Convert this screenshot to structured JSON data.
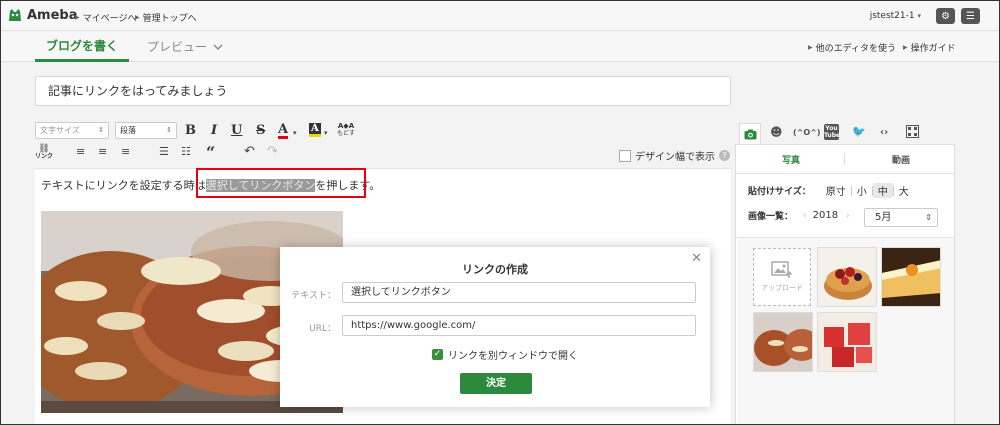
{
  "brand": {
    "name": "Ameba",
    "color": "#2b8a3e"
  },
  "topnav": {
    "mypage": "マイページへ",
    "admin_top": "管理トップへ",
    "user": "jstest21-1"
  },
  "tabs": {
    "write": "ブログを書く",
    "preview": "プレビュー"
  },
  "tablinks": {
    "other_editor": "他のエディタを使う",
    "guide": "操作ガイド"
  },
  "title": "記事にリンクをはってみましょう",
  "toolbar": {
    "font_size": "文字サイズ",
    "paragraph": "段落",
    "bold": "B",
    "italic": "I",
    "underline": "U",
    "strike": "S",
    "font_color": "A",
    "bg_color": "A",
    "clear_format_top": "A◆A",
    "clear_format_bottom": "もどす",
    "link": "リンク",
    "quote": "“",
    "design_width": "デザイン幅で表示"
  },
  "editor": {
    "text_before": "テキストにリンクを設定する時は",
    "text_selected": "選択してリンクボタン",
    "text_after": "を押します。"
  },
  "panel": {
    "icons": [
      "camera-icon",
      "emoji-icon",
      "kaomoji-icon",
      "youtube-icon",
      "twitter-icon",
      "embed-icon",
      "qr-icon"
    ],
    "kaomoji": "(^O^)",
    "youtube": "You Tube",
    "embed": "‹›",
    "subtabs": {
      "photo": "写真",
      "video": "動画"
    },
    "paste_size_label": "貼付けサイズ：",
    "sizes": [
      "原寸",
      "小",
      "中",
      "大"
    ],
    "selected_size": "中",
    "image_list_label": "画像一覧：",
    "year": "2018",
    "month": "5月",
    "upload": "アップロード"
  },
  "modal": {
    "title": "リンクの作成",
    "text_label": "テキスト：",
    "text_value": "選択してリンクボタン",
    "url_label": "URL：",
    "url_value": "https://www.google.com/",
    "new_window": "リンクを別ウィンドウで開く",
    "new_window_checked": true,
    "submit": "決定"
  },
  "colors": {
    "highlight_box": "#e60012",
    "accent": "#2b8a3e"
  }
}
